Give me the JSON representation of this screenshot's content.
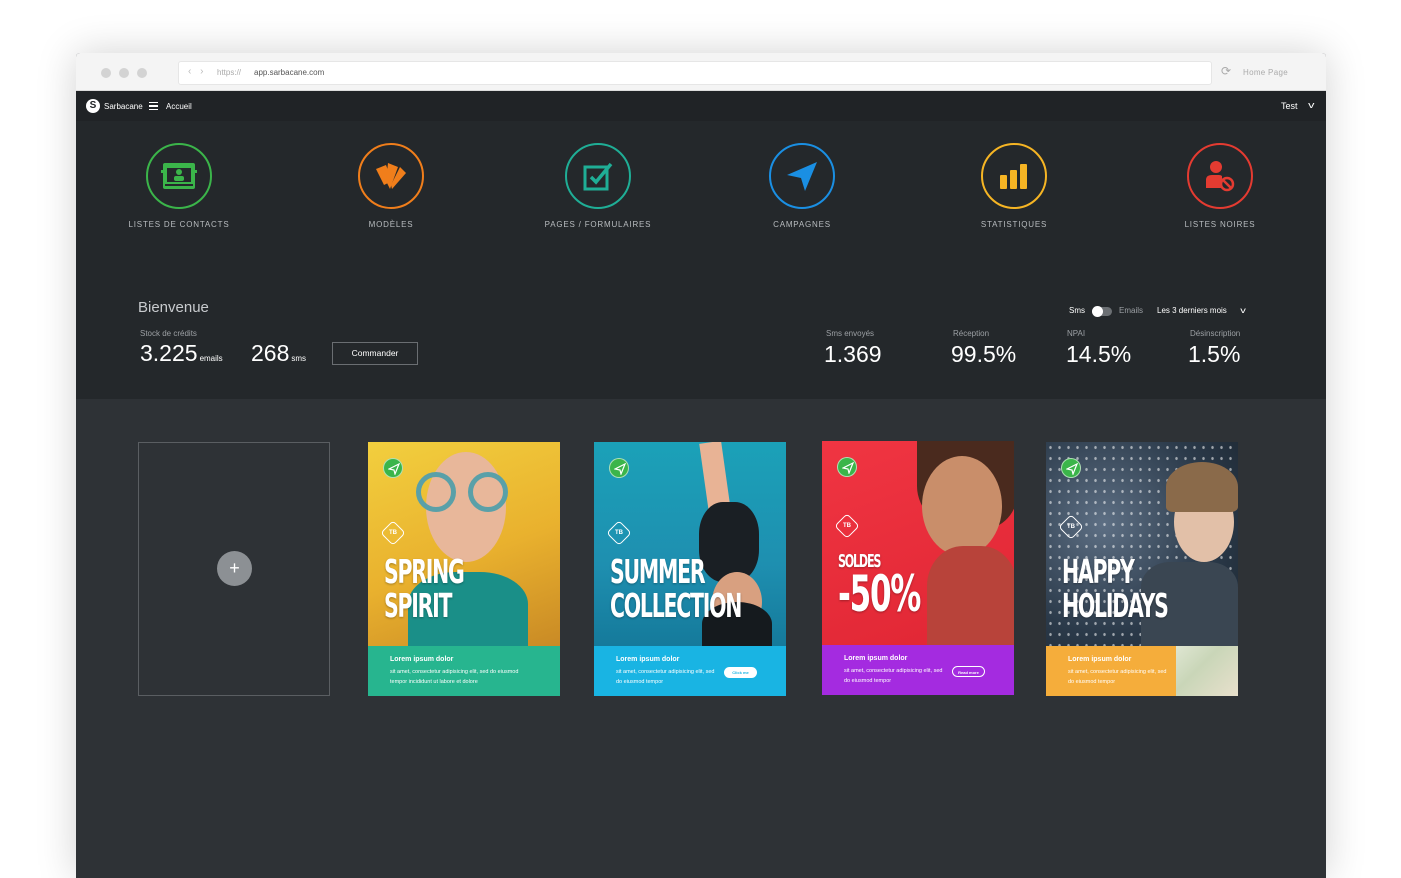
{
  "browser": {
    "url_protocol": "https://",
    "url_host": "app.sarbacane.com",
    "home_label": "Home Page"
  },
  "topbar": {
    "brand": "Sarbacane",
    "nav": "Accueil",
    "user": "Test"
  },
  "modules": [
    {
      "label": "LISTES DE CONTACTS",
      "icon": "contacts-icon",
      "color": "#3bb54a"
    },
    {
      "label": "MODÈLES",
      "icon": "templates-icon",
      "color": "#f07e1b"
    },
    {
      "label": "PAGES / FORMULAIRES",
      "icon": "forms-icon",
      "color": "#1fae96"
    },
    {
      "label": "CAMPAGNES",
      "icon": "paper-plane-icon",
      "color": "#1a8fe3"
    },
    {
      "label": "STATISTIQUES",
      "icon": "bar-chart-icon",
      "color": "#f6b524"
    },
    {
      "label": "LISTES NOIRES",
      "icon": "blacklist-icon",
      "color": "#e43b31"
    }
  ],
  "welcome": {
    "title": "Bienvenue",
    "stock_label": "Stock de crédits",
    "emails_value": "3.225",
    "emails_unit": "emails",
    "sms_value": "268",
    "sms_unit": "sms",
    "order_button": "Commander",
    "toggle_sms": "Sms",
    "toggle_emails": "Emails",
    "period": "Les 3 derniers mois"
  },
  "stats": [
    {
      "label": "Sms envoyés",
      "value": "1.369"
    },
    {
      "label": "Réception",
      "value": "99.5%"
    },
    {
      "label": "NPAI",
      "value": "14.5%"
    },
    {
      "label": "Désinscription",
      "value": "1.5%"
    }
  ],
  "templates": [
    {
      "line1": "SPRING",
      "line2": "SPIRIT",
      "band_title": "Lorem ipsum dolor",
      "band_text": "sit amet, consectetur adipisicing elit, sed do eiusmod tempor incididunt ut labore et dolore",
      "button": "",
      "photo_color": "#e8b93a",
      "band_color": "#27b58f"
    },
    {
      "line1": "SUMMER",
      "line2": "COLLECTION",
      "band_title": "Lorem ipsum dolor",
      "band_text": "sit amet, consectetur adipisicing elit, sed do eiusmod tempor",
      "button": "Click me",
      "photo_color": "#1e9fb5",
      "band_color": "#19b4e3"
    },
    {
      "line1": "SOLDES",
      "line2": "-50%",
      "band_title": "Lorem ipsum dolor",
      "band_text": "sit amet, consectetur adipisicing elit, sed do eiusmod tempor",
      "button": "Read more",
      "photo_color": "#e92a3a",
      "band_color": "#a42be0"
    },
    {
      "line1": "HAPPY",
      "line2": "HOLIDAYS",
      "band_title": "Lorem ipsum dolor",
      "band_text": "sit amet, consectetur adipisicing elit, sed do eiusmod tempor",
      "button": "",
      "photo_color": "#2b3a4a",
      "band_color": "#f5ad3b"
    }
  ],
  "tb_badge": "TB"
}
